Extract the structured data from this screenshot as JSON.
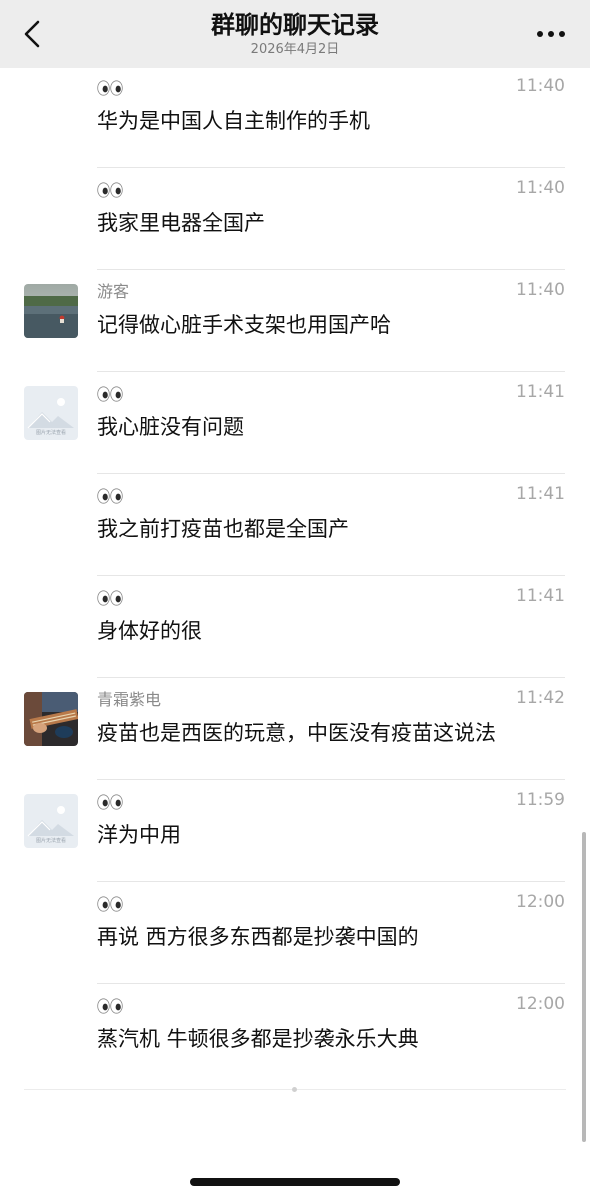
{
  "header": {
    "title": "群聊的聊天记录",
    "subtitle": "2026年4月2日",
    "back_icon": "chevron-left-icon",
    "more_icon": "ellipsis-icon"
  },
  "messages": [
    {
      "sender": "",
      "sender_icon": "eyes-icon",
      "avatar": "none",
      "time": "11:40",
      "text": "华为是中国人自主制作的手机"
    },
    {
      "sender": "",
      "sender_icon": "eyes-icon",
      "avatar": "none",
      "time": "11:40",
      "text": "我家里电器全国产"
    },
    {
      "sender": "游客",
      "sender_icon": "",
      "avatar": "landscape-photo",
      "time": "11:40",
      "text": "记得做心脏手术支架也用国产哈"
    },
    {
      "sender": "",
      "sender_icon": "eyes-icon",
      "avatar": "placeholder-image",
      "time": "11:41",
      "text": "我心脏没有问题"
    },
    {
      "sender": "",
      "sender_icon": "eyes-icon",
      "avatar": "none",
      "time": "11:41",
      "text": "我之前打疫苗也都是全国产"
    },
    {
      "sender": "",
      "sender_icon": "eyes-icon",
      "avatar": "none",
      "time": "11:41",
      "text": "身体好的很"
    },
    {
      "sender": "青霜紫电",
      "sender_icon": "",
      "avatar": "guitar-photo",
      "time": "11:42",
      "text": "疫苗也是西医的玩意，中医没有疫苗这说法"
    },
    {
      "sender": "",
      "sender_icon": "eyes-icon",
      "avatar": "placeholder-image",
      "time": "11:59",
      "text": "洋为中用"
    },
    {
      "sender": "",
      "sender_icon": "eyes-icon",
      "avatar": "none",
      "time": "12:00",
      "text": "再说 西方很多东西都是抄袭中国的"
    },
    {
      "sender": "",
      "sender_icon": "eyes-icon",
      "avatar": "none",
      "time": "12:00",
      "text": "蒸汽机 牛顿很多都是抄袭永乐大典"
    }
  ],
  "placeholder_avatar_caption": "图片无法查看",
  "colors": {
    "header_bg": "#ededed",
    "text": "#111111",
    "secondary": "#8a8a8a",
    "time": "#a7a7a7",
    "divider": "#e6e6e6"
  }
}
